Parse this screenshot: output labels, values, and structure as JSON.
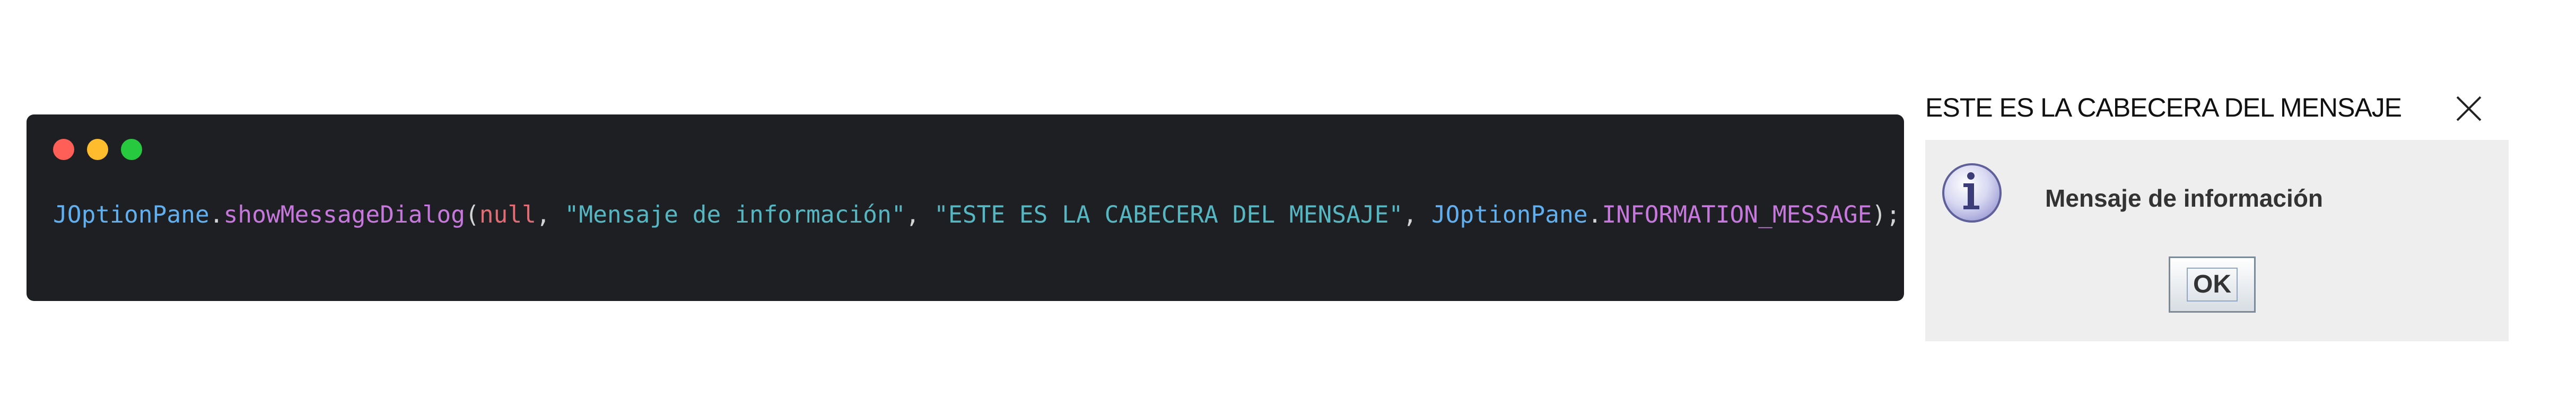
{
  "code_panel": {
    "tokens": {
      "class1": "JOptionPane",
      "dot1": ".",
      "method": "showMessageDialog",
      "open": "(",
      "null_kw": "null",
      "comma1": ", ",
      "message_str": "\"Mensaje de información\"",
      "comma2": ", ",
      "title_str": "\"ESTE ES LA CABECERA DEL MENSAJE\"",
      "comma3": ", ",
      "class2": "JOptionPane",
      "dot2": ".",
      "constant": "INFORMATION_MESSAGE",
      "close": ");"
    },
    "colors": {
      "background": "#1e1f22",
      "traffic_red": "#ff5f56",
      "traffic_yellow": "#ffbd2e",
      "traffic_green": "#27c93f"
    }
  },
  "dialog": {
    "title": "ESTE ES LA CABECERA DEL MENSAJE",
    "message": "Mensaje de información",
    "ok_label": "OK",
    "icon": "info-icon",
    "close_icon": "close-icon"
  }
}
